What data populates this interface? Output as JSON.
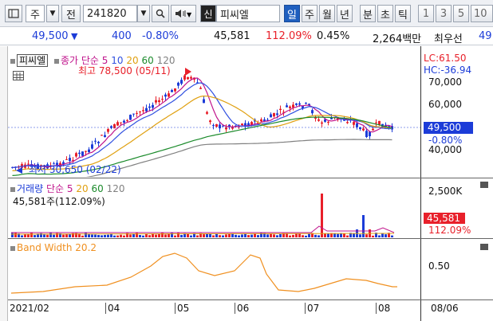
{
  "toolbar": {
    "type_label": "주",
    "view_label": "전",
    "stock_code": "241820",
    "stock_tag": "신",
    "stock_name": "피씨엘",
    "periods": [
      "일",
      "주",
      "월",
      "년",
      "분",
      "초",
      "틱"
    ],
    "intervals": [
      "1",
      "3",
      "5",
      "10"
    ]
  },
  "info": {
    "price": "49,500",
    "change": "400",
    "change_pct": "-0.80%",
    "volume": "45,581",
    "volume_ratio": "112.09%",
    "turnover": "0.45%",
    "amount": "2,264백만",
    "extra": "최우선",
    "extra2": "49"
  },
  "price_panel": {
    "title_tag": "피씨엘",
    "ma_label": "종가 단순",
    "ma_periods": [
      "5",
      "10",
      "20",
      "60",
      "120"
    ],
    "high_note": "최고 78,500 (05/11)",
    "low_note": "최저 30,650 (02/22)",
    "lc": "LC:61.50",
    "hc": "HC:-36.94",
    "axis_ticks": [
      "70,000",
      "60,000",
      "50,000",
      "40,000"
    ],
    "current_price": "49,500",
    "current_pct": "-0.80%"
  },
  "volume_panel": {
    "title": "거래량",
    "ma_label": "단순",
    "ma_periods": [
      "5",
      "20",
      "60",
      "120"
    ],
    "value_text": "45,581주(112.09%)",
    "axis_tick": "2,500K",
    "current": "45,581",
    "current_pct": "112.09%"
  },
  "band_panel": {
    "title": "Band Width 20.2",
    "axis_tick": "0.50"
  },
  "date_axis": {
    "labels": [
      "2021/02",
      "04",
      "05",
      "06",
      "07",
      "08"
    ],
    "end_label": "08/06"
  },
  "colors": {
    "up": "#e8202a",
    "down": "#1c3cd8",
    "ma5": "#c0148c",
    "ma10": "#3050e0",
    "ma20": "#e0a010",
    "ma60": "#1a8a2a",
    "ma120": "#808080",
    "band": "#f09020"
  }
}
